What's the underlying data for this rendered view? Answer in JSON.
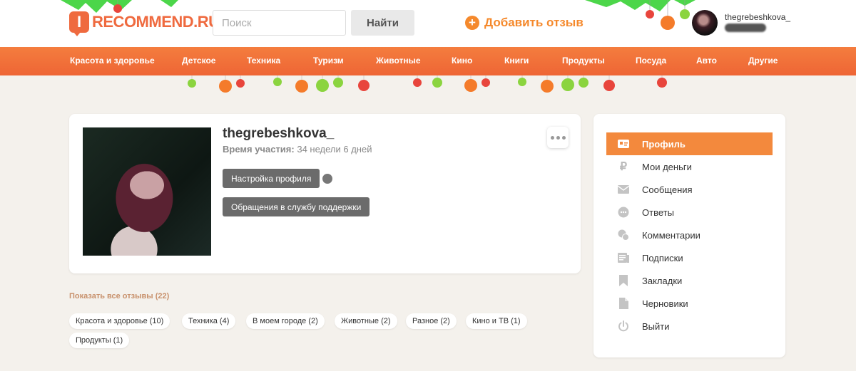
{
  "header": {
    "logo_badge": "I",
    "logo_text": "RECOMMEND.RU",
    "search_placeholder": "Поиск",
    "search_button": "Найти",
    "add_review": "Добавить отзыв",
    "add_review_icon": "plus-circle-icon",
    "username": "thegrebeshkova_"
  },
  "nav": {
    "items": [
      "Красота и здоровье",
      "Детское",
      "Техника",
      "Туризм",
      "Животные",
      "Кино",
      "Книги",
      "Продукты",
      "Посуда",
      "Авто",
      "Другие"
    ]
  },
  "profile": {
    "username": "thegrebeshkova_",
    "membership_label": "Время участия:",
    "membership_value": "34 недели 6 дней",
    "settings_button": "Настройка профиля",
    "support_button": "Обращения в службу поддержки"
  },
  "reviews": {
    "show_all": "Показать все отзывы (22)",
    "tags": [
      "Красота и здоровье (10)",
      "Техника (4)",
      "В моем городе (2)",
      "Животные (2)",
      "Разное (2)",
      "Кино и ТВ (1)",
      "Продукты (1)"
    ]
  },
  "sidebar": {
    "items": [
      {
        "label": "Профиль",
        "icon": "id-card-icon",
        "active": true
      },
      {
        "label": "Мои деньги",
        "icon": "ruble-icon",
        "active": false
      },
      {
        "label": "Сообщения",
        "icon": "envelope-icon",
        "active": false
      },
      {
        "label": "Ответы",
        "icon": "speech-bubble-icon",
        "active": false
      },
      {
        "label": "Комментарии",
        "icon": "comments-icon",
        "active": false
      },
      {
        "label": "Подписки",
        "icon": "newspaper-icon",
        "active": false
      },
      {
        "label": "Закладки",
        "icon": "bookmark-icon",
        "active": false
      },
      {
        "label": "Черновики",
        "icon": "document-icon",
        "active": false
      },
      {
        "label": "Выйти",
        "icon": "power-icon",
        "active": false
      }
    ]
  },
  "colors": {
    "brand_orange": "#ef6a3f",
    "accent_orange": "#f3893d",
    "dark_button": "#6b6b6b"
  }
}
